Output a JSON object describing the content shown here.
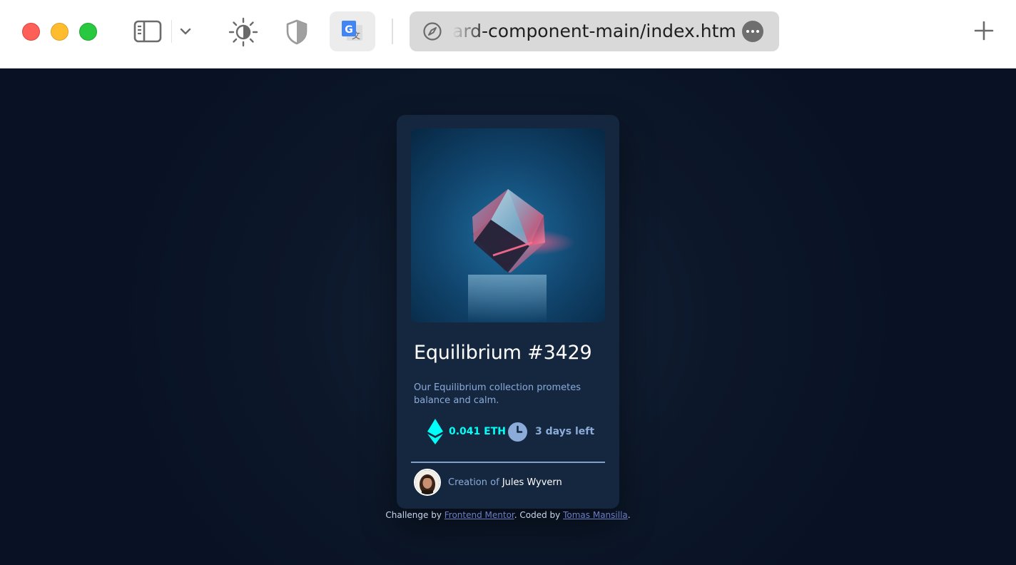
{
  "browser": {
    "address_text": "ard-component-main/index.html"
  },
  "card": {
    "title": "Equilibrium #3429",
    "description": "Our Equilibrium collection prometes balance and calm.",
    "price": "0.041 ETH",
    "time_left": "3 days left",
    "creator_prefix": "Creation of",
    "creator_name": "Jules Wyvern"
  },
  "attribution": {
    "challenge_prefix": "Challenge by",
    "challenge_link": "Frontend Mentor",
    "coded_prefix": ". Coded by",
    "coded_link": "Tomas Mansilla",
    "suffix": "."
  },
  "colors": {
    "page_background": "#0d1a2e",
    "card_background": "#15263f",
    "cyan_accent": "#00fff8",
    "soft_blue": "#8bacd9",
    "link": "#6a7ec5"
  },
  "icons": {
    "sidebar": "sidebar-icon",
    "chevron": "chevron-down-icon",
    "appearance": "sun-icon",
    "privacy": "shield-icon",
    "translate": "translate-icon",
    "compass": "compass-icon",
    "more": "more-icon",
    "new_tab": "plus-icon",
    "eth": "ethereum-icon",
    "clock": "clock-icon"
  }
}
